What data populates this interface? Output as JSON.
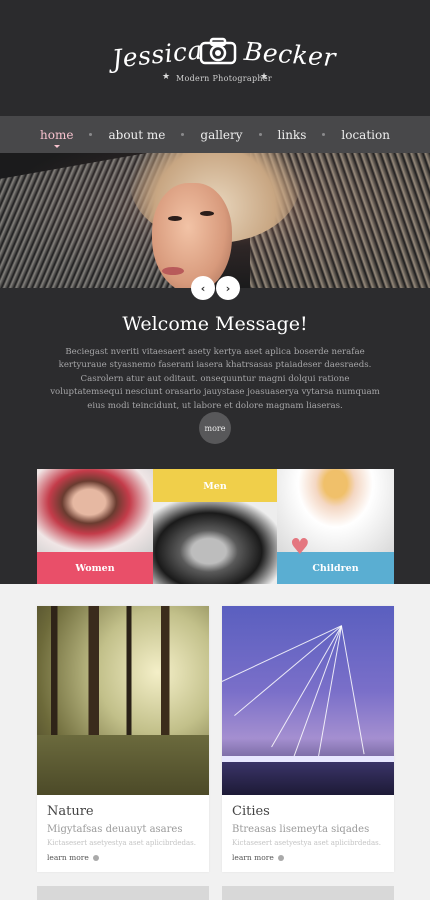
{
  "header": {
    "first_name": "Jessica",
    "last_name": "Becker",
    "tagline": "Modern Photographer",
    "logo_icon": "camera-icon",
    "star_glyph": "★"
  },
  "nav": {
    "items": [
      {
        "label": "home",
        "active": true
      },
      {
        "label": "about me",
        "active": false
      },
      {
        "label": "gallery",
        "active": false
      },
      {
        "label": "links",
        "active": false
      },
      {
        "label": "location",
        "active": false
      }
    ]
  },
  "hero": {
    "prev_icon": "chevron-left-icon",
    "next_icon": "chevron-right-icon",
    "prev_glyph": "‹",
    "next_glyph": "›"
  },
  "welcome": {
    "title": "Welcome Message!",
    "text": "Beciegast nveriti vitaesaert asety kertya aset aplica boserde nerafae kertyuraue styasnemo faserani iasera khatrsasas ptaiadeser daesraeds. Casrolern atur aut oditaut. onsequuntur magni dolqui ratione voluptatemsequi nesciunt orasario jauystase joasuaserya vytarsa numquam eius modi teincidunt, ut labore et dolore magnam liaseras.",
    "more_label": "more"
  },
  "categories": {
    "women": "Women",
    "men": "Men",
    "children": "Children"
  },
  "cards": [
    {
      "title": "Nature",
      "subtitle": "Migytafsas deuauyt asares",
      "desc": "Kictasesert asetyestya aset aplicibrdedas.",
      "link": "learn more"
    },
    {
      "title": "Cities",
      "subtitle": "Btreasas lisemeyta siqades",
      "desc": "Kictasesert asetyestya aset aplicibrdedas.",
      "link": "learn more"
    }
  ],
  "colors": {
    "accent_pink": "#e94f69",
    "accent_yellow": "#f0cf4a",
    "accent_blue": "#5aaed2",
    "nav_active": "#f7c2ce"
  }
}
